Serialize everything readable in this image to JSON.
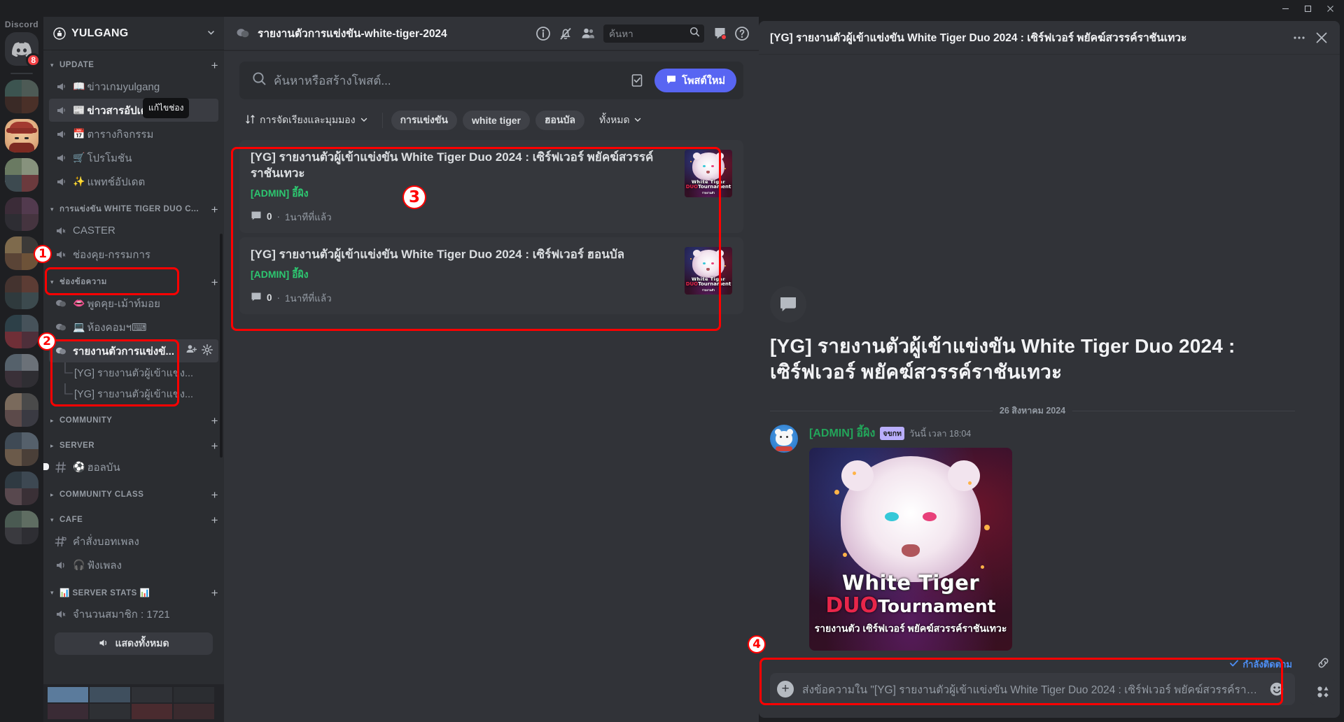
{
  "window": {
    "minimize": "–",
    "maximize": "□",
    "close": "✕"
  },
  "rail": {
    "app_word": "Discord",
    "home_badge": "8",
    "home_icon": "discord-logo-icon"
  },
  "sidebar": {
    "guild_name": "YULGANG",
    "guild_icon": "server-boost-icon",
    "dropdown_icon": "chevron-down-icon",
    "tooltip": "แก้ไขช่อง",
    "categories": [
      {
        "label": "UPDATE",
        "expanded": true,
        "add_label": "+",
        "channels": [
          {
            "emoji": "📖",
            "label": "ข่าวเกมyulgang",
            "type": "announcement",
            "active": false
          },
          {
            "emoji": "📰",
            "label": "ข่าวสารอัปเดต",
            "type": "announcement",
            "active": true
          },
          {
            "emoji": "📅",
            "label": "ตารางกิจกรรม",
            "type": "announcement",
            "active": false
          },
          {
            "emoji": "🛒",
            "label": "โปรโมชัน",
            "type": "announcement",
            "active": false
          },
          {
            "emoji": "✨",
            "label": "แพทช์อัปเดต",
            "type": "announcement",
            "active": false
          }
        ]
      },
      {
        "label": "การแข่งขัน WHITE TIGER DUO C...",
        "expanded": true,
        "add_label": "+",
        "channels": [
          {
            "emoji": "",
            "label": "CASTER",
            "type": "voice",
            "active": false
          },
          {
            "emoji": "",
            "label": "ช่องคุย-กรรมการ",
            "type": "voice",
            "active": false
          }
        ]
      },
      {
        "label": "ช่องข้อความ",
        "expanded": true,
        "add_label": "+",
        "highlighted": true,
        "channels": [
          {
            "emoji": "👄",
            "label": "พูดคุย-เม้าท์มอย",
            "type": "forum",
            "active": false
          },
          {
            "emoji": "💻",
            "label": "ห้องคอมฯ⌨",
            "type": "forum",
            "active": false
          },
          {
            "emoji": "",
            "label": "รายงานตัวการแข่งขั...",
            "type": "forum",
            "active": true,
            "actions": [
              "add-member-icon",
              "gear-icon"
            ]
          }
        ],
        "threads": [
          {
            "label": "[YG] รายงานตัวผู้เข้าแข่ง..."
          },
          {
            "label": "[YG] รายงานตัวผู้เข้าแข่ง..."
          }
        ]
      },
      {
        "label": "COMMUNITY",
        "expanded": false,
        "add_label": "+",
        "channels": []
      },
      {
        "label": "SERVER",
        "expanded": false,
        "add_label": "+",
        "channels": [
          {
            "emoji": "⚽",
            "label": "ฮอลบัน",
            "type": "text",
            "active": false,
            "unread": true
          }
        ]
      },
      {
        "label": "COMMUNITY CLASS",
        "expanded": false,
        "add_label": "+",
        "channels": []
      },
      {
        "label": "CAFE",
        "expanded": true,
        "add_label": "+",
        "channels": [
          {
            "emoji": "",
            "label": "คำสั่งบอทเพลง",
            "type": "text-locked",
            "active": false
          },
          {
            "emoji": "🎧",
            "label": "ฟังเพลง",
            "type": "voice2",
            "active": false
          }
        ]
      },
      {
        "label": "📊 SERVER STATS 📊",
        "expanded": true,
        "add_label": "+",
        "channels": [
          {
            "emoji": "",
            "label": "จำนวนสมาชิก : 1721",
            "type": "voice",
            "active": false
          }
        ]
      }
    ],
    "show_all_label": "แสดงทั้งหมด"
  },
  "center": {
    "channel_icon": "forum-channel-icon",
    "channel_title": "รายงานตัวการแข่งขัน-white-tiger-2024",
    "header_icons": [
      "info-icon",
      "notification-muted-icon",
      "members-icon"
    ],
    "search_placeholder": "ค้นหา",
    "search_icon": "search-icon",
    "inbox_icon": "inbox-icon",
    "help_icon": "help-icon",
    "forum_search_placeholder": "ค้นหาหรือสร้างโพสต์...",
    "new_post_label": "โพสต์ใหม่",
    "new_post_icon": "new-post-icon",
    "checkbox_icon": "mark-read-icon",
    "sort_label": "การจัดเรียงและมุมมอง",
    "sort_icon": "sort-icon",
    "tags": [
      {
        "label": "การแข่งขัน",
        "type": "pill"
      },
      {
        "label": "white tiger",
        "type": "pill"
      },
      {
        "label": "ฮอนบัล",
        "type": "pill"
      },
      {
        "label": "ทั้งหมด",
        "type": "dropdown"
      }
    ],
    "posts": [
      {
        "title": "[YG] รายงานตัวผู้เข้าแข่งขัน White Tiger Duo 2024 : เซิร์ฟเวอร์ พยัคฆ์สวรรค์ราชันเทวะ",
        "author": "[ADMIN] อี้ผิง",
        "comment_count": "0",
        "time": "1นาทีที่แล้ว",
        "thumb_title1": "White Tiger",
        "thumb_title2": "DUO",
        "thumb_title3": "Tournament"
      },
      {
        "title": "[YG] รายงานตัวผู้เข้าแข่งขัน White Tiger Duo 2024 : เซิร์ฟเวอร์ ฮอนบัล",
        "author": "[ADMIN] อี้ผิง",
        "comment_count": "0",
        "time": "1นาทีที่แล้ว",
        "thumb_title1": "White Tiger",
        "thumb_title2": "DUO",
        "thumb_title3": "Tournament"
      }
    ]
  },
  "thread_panel": {
    "header_title": "[YG] รายงานตัวผู้เข้าแข่งขัน White Tiger Duo 2024 : เซิร์ฟเวอร์ พยัคฆ์สวรรค์ราชันเทวะ",
    "more_icon": "more-options-icon",
    "close_icon": "close-icon",
    "starter_icon": "thread-bubble-icon",
    "big_title": "[YG] รายงานตัวผู้เข้าแข่งขัน White Tiger Duo 2024 : เซิร์ฟเวอร์ พยัคฆ์สวรรค์ราชันเทวะ",
    "date_separator": "26 สิงหาคม 2024",
    "message": {
      "author": "[ADMIN] อี้ผิง",
      "badge": "จขกท",
      "timestamp": "วันนี้ เวลา 18:04",
      "image_title1": "White Tiger",
      "image_title2": "DUO",
      "image_title3": "Tournament",
      "image_subtitle": "รายงานตัว เซิร์ฟเวอร์ พยัคฆ์สวรรค์ราชันเทวะ"
    },
    "following_label": "กำลังติดตาม",
    "following_icon": "check-icon",
    "link_icon": "link-icon",
    "compose_placeholder": "ส่งข้อความใน \"[YG] รายงานตัวผู้เข้าแข่งขัน White Tiger Duo 2024 : เซิร์ฟเวอร์ พยัคฆ์สวรรค์ราชั...",
    "plus_label": "+",
    "emoji_icon": "emoji-icon",
    "apps_icon": "apps-grid-icon"
  },
  "annotations": {
    "markers": [
      "1",
      "2",
      "3",
      "4"
    ],
    "color": "#ff0000"
  }
}
